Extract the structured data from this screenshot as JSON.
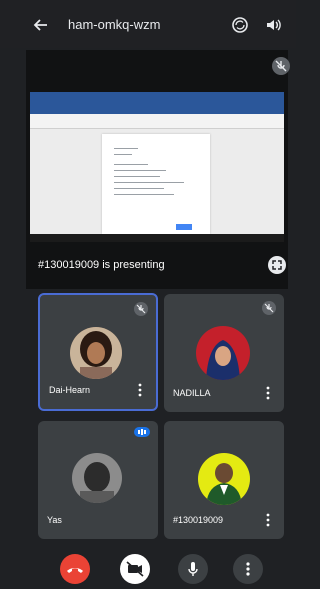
{
  "meeting": {
    "title": "ham-omkq-wzm",
    "presenting_text": "#130019009 is presenting"
  },
  "participants": [
    {
      "name": "Dai-Hearn",
      "muted": true,
      "speaking": false,
      "active": true
    },
    {
      "name": "NADILLA",
      "muted": true,
      "speaking": false,
      "active": false
    },
    {
      "name": "Yas",
      "muted": false,
      "speaking": true,
      "active": false
    },
    {
      "name": "#130019009",
      "muted": false,
      "speaking": false,
      "active": false
    }
  ],
  "controls": [
    {
      "name": "end-call",
      "icon": "phone-hangup-icon",
      "color": "#ea4335"
    },
    {
      "name": "camera",
      "icon": "camera-off-icon",
      "color": "#ffffff"
    },
    {
      "name": "microphone",
      "icon": "microphone-icon",
      "color": "#3c4043"
    },
    {
      "name": "more",
      "icon": "more-vert-icon",
      "color": "#3c4043"
    }
  ],
  "colors": {
    "background": "#1f2124",
    "tile": "#3c4043",
    "active_border": "#4a6cd4",
    "end_call": "#ea4335"
  }
}
